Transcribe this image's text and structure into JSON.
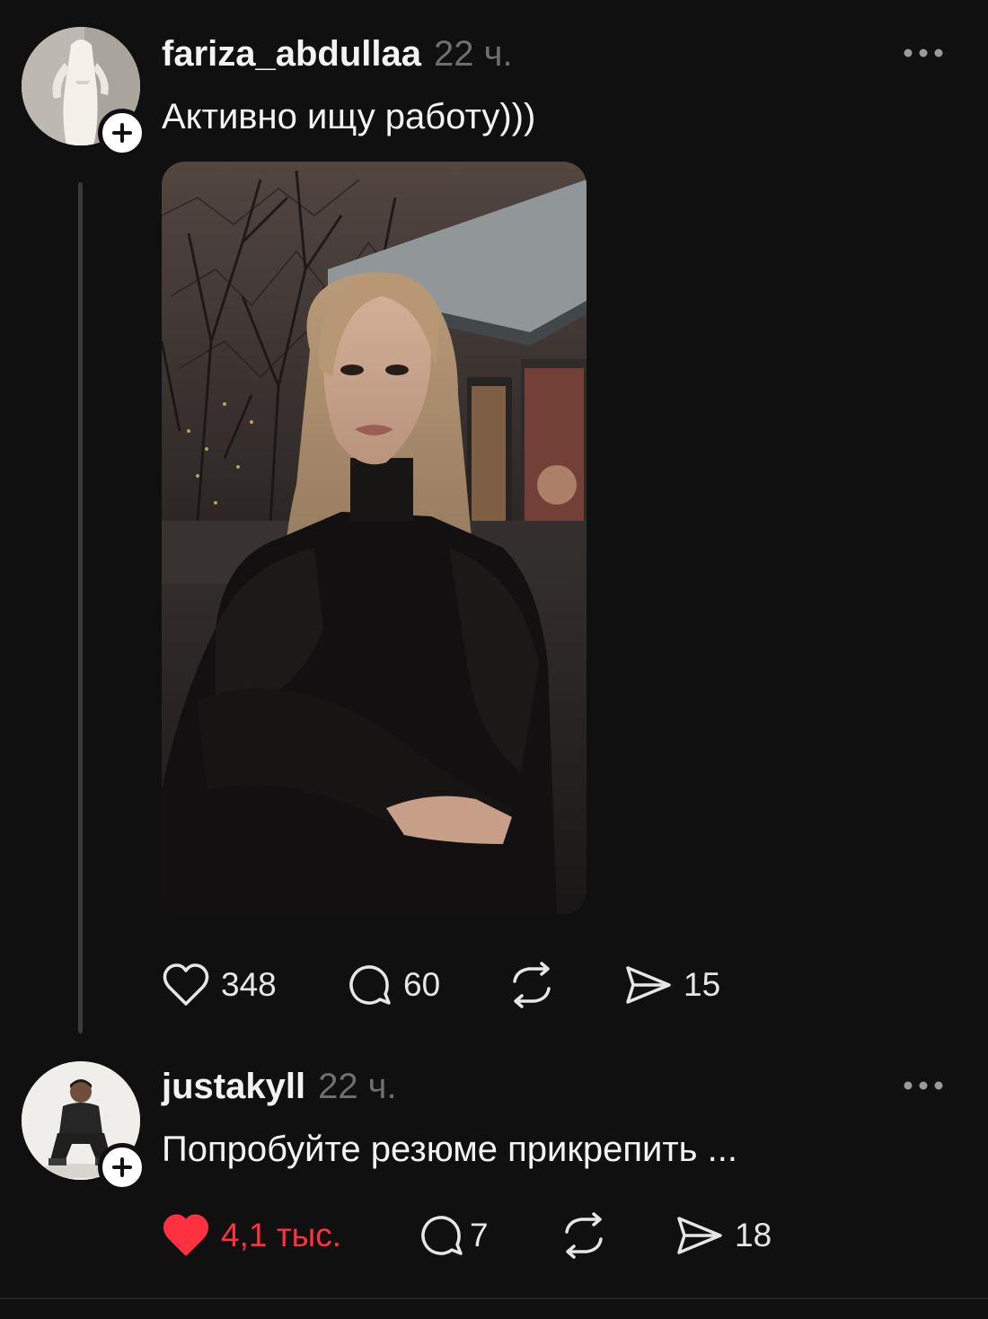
{
  "posts": [
    {
      "username": "fariza_abdullaa",
      "time": "22 ч.",
      "text": "Активно ищу работу)))",
      "likes": "348",
      "comments": "60",
      "shares": "15",
      "liked": false
    },
    {
      "username": "justakyll",
      "time": "22 ч.",
      "text": "Попробуйте резюме прикрепить ...",
      "likes": "4,1 тыс.",
      "comments": "7",
      "shares": "18",
      "liked": true
    }
  ],
  "colors": {
    "background": "#101010",
    "like_active": "#ff3040",
    "muted": "#6e6e6e"
  },
  "icons": [
    "heart-icon",
    "comment-icon",
    "repost-icon",
    "share-icon",
    "more-icon",
    "plus-icon"
  ]
}
